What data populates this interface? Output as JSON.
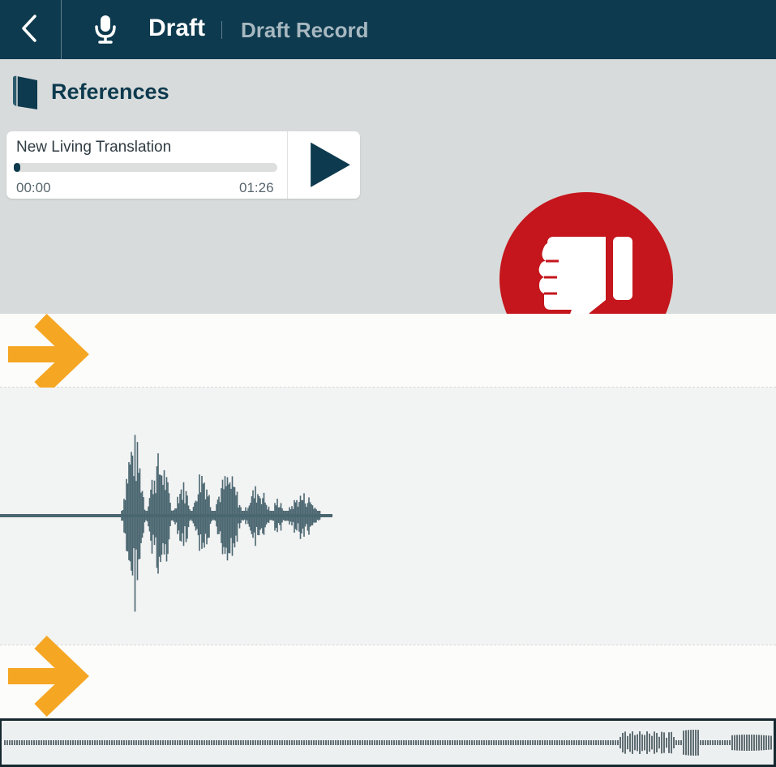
{
  "header": {
    "title": "Draft",
    "subtitle": "Draft Record",
    "back_icon": "chevron-left-icon",
    "mic_icon": "microphone-icon",
    "background": "#0d3a4e"
  },
  "references": {
    "heading": "References",
    "icon": "book-icon",
    "background": "#d8dbdb",
    "player": {
      "title": "New Living Translation",
      "time_current": "00:00",
      "time_total": "01:26",
      "progress_fraction": 0.02,
      "play_icon": "play-icon"
    },
    "feedback_icon": "thumbs-down-icon",
    "feedback_color": "#c4161c"
  },
  "markers": {
    "arrow_icon": "arrow-right-icon",
    "arrow_color": "#f5a623"
  },
  "waveform": {
    "color": "#4a6670"
  }
}
